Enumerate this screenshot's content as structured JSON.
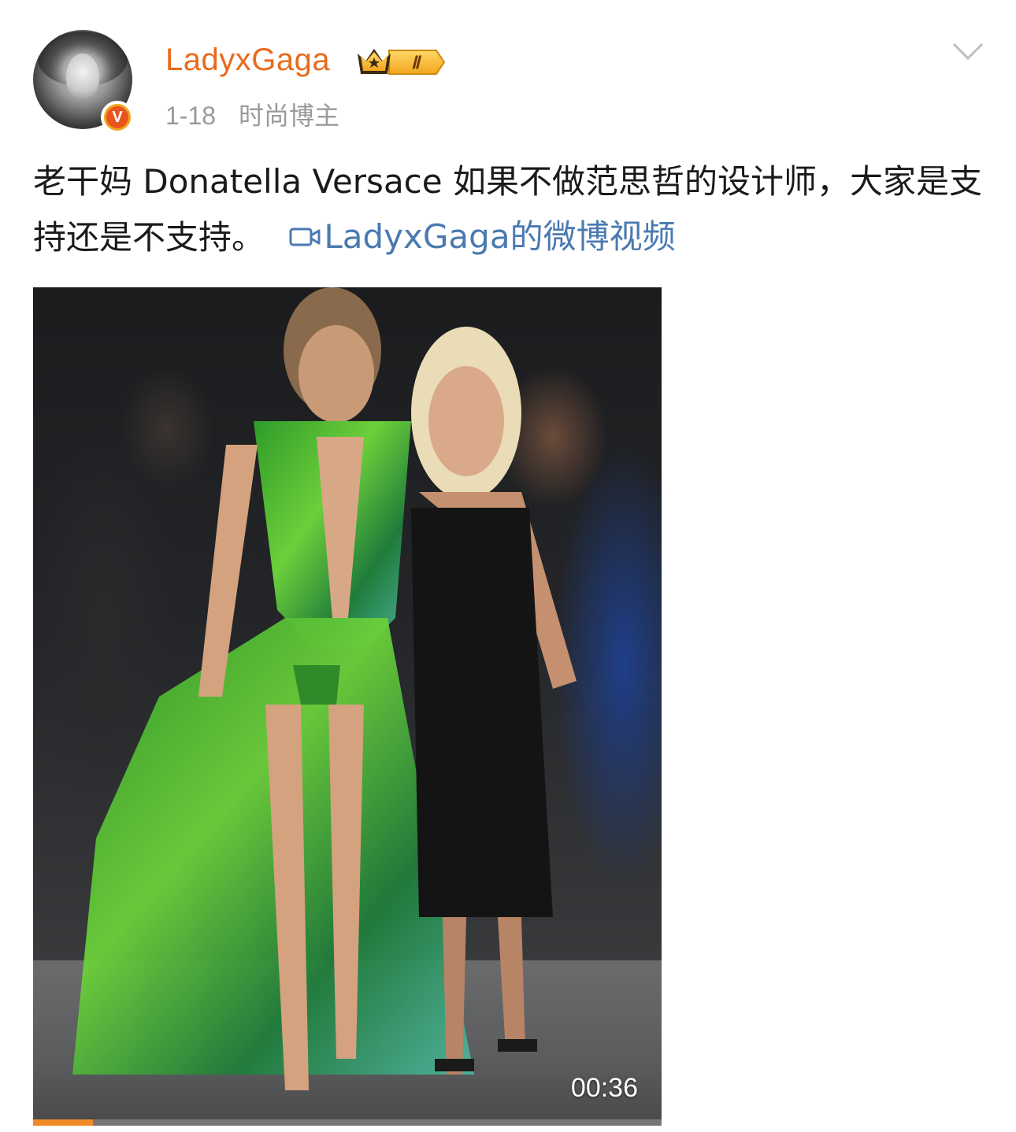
{
  "post": {
    "author": {
      "name": "LadyxGaga",
      "avatar_icon": "avatar-portrait",
      "verified_badge": "V",
      "verified_color": "#f0a420",
      "member_level": "Ⅱ",
      "member_badge_icon": "crown-icon"
    },
    "date": "1-18",
    "category": "时尚博主",
    "text": "老干妈 Donatella Versace 如果不做范思哲的设计师，大家是支持还是不支持。",
    "video_link_label": "LadyxGaga的微博视频",
    "video_link_icon": "video-camera-icon",
    "link_color": "#4a7ab0",
    "username_color": "#e86b1c",
    "menu_icon": "chevron-down-icon"
  },
  "video": {
    "duration": "00:36",
    "progress_fraction": 0.095,
    "progress_color": "#f08a24"
  }
}
